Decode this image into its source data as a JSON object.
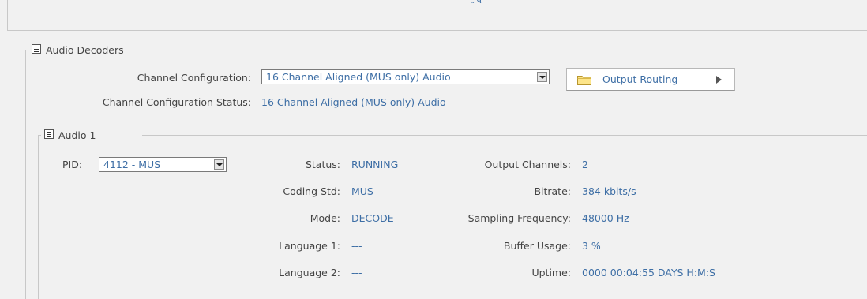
{
  "audio_decoders": {
    "legend": "Audio Decoders",
    "channel_config_label": "Channel Configuration:",
    "channel_config_value": "16 Channel Aligned (MUS only) Audio",
    "channel_status_label": "Channel Configuration Status:",
    "channel_status_value": "16 Channel Aligned (MUS only) Audio",
    "output_routing_label": "Output Routing"
  },
  "audio1": {
    "legend": "Audio 1",
    "pid_label": "PID:",
    "pid_value": "4112 - MUS",
    "status_label": "Status:",
    "status_value": "RUNNING",
    "coding_label": "Coding Std:",
    "coding_value": "MUS",
    "mode_label": "Mode:",
    "mode_value": "DECODE",
    "lang1_label": "Language 1:",
    "lang1_value": "---",
    "lang2_label": "Language 2:",
    "lang2_value": "---",
    "outch_label": "Output Channels:",
    "outch_value": "2",
    "bitrate_label": "Bitrate:",
    "bitrate_value": "384 kbits/s",
    "sampling_label": "Sampling Frequency:",
    "sampling_value": "48000 Hz",
    "buffer_label": "Buffer Usage:",
    "buffer_value": "3 %",
    "uptime_label": "Uptime:",
    "uptime_value": "0000 00:04:55 DAYS H:M:S"
  }
}
